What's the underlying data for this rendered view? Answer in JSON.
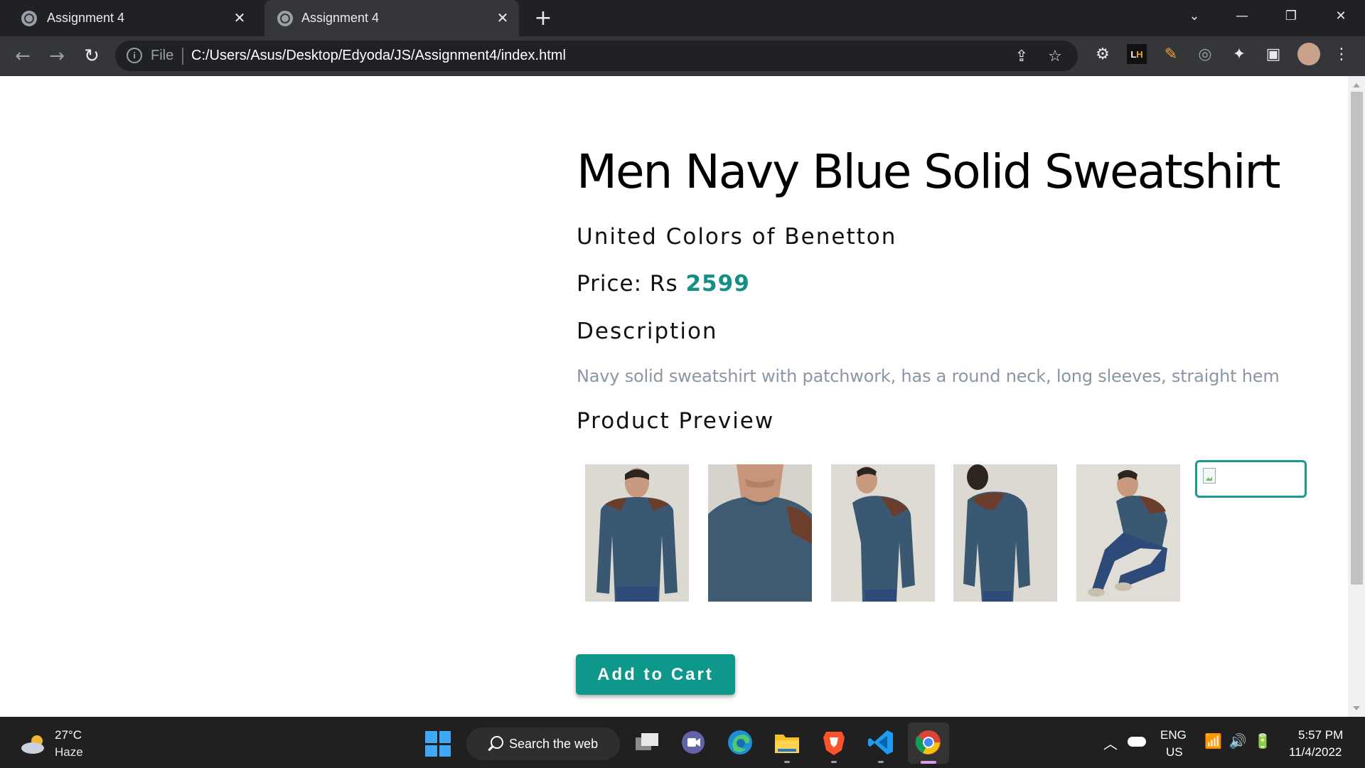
{
  "browser": {
    "tabs": [
      {
        "title": "Assignment 4"
      },
      {
        "title": "Assignment 4"
      }
    ],
    "address": {
      "scheme_label": "File",
      "url": "C:/Users/Asus/Desktop/Edyoda/JS/Assignment4/index.html"
    },
    "extensions": [
      "gear-extension-icon",
      "lighthouse-extension-icon",
      "pen-extension-icon",
      "screen-reader-extension-icon",
      "puzzle-icon",
      "side-panel-icon",
      "profile-avatar"
    ]
  },
  "product": {
    "title": "Men Navy Blue Solid Sweatshirt",
    "brand": "United Colors of Benetton",
    "price_label": "Price: Rs",
    "price_value": "2599",
    "description_heading": "Description",
    "description": "Navy solid sweatshirt with patchwork, has a round neck, long sleeves, straight hem",
    "preview_heading": "Product Preview",
    "preview_images": [
      {
        "alt": "front view"
      },
      {
        "alt": "neck close-up"
      },
      {
        "alt": "side view"
      },
      {
        "alt": "back view"
      },
      {
        "alt": "seated view"
      },
      {
        "alt": "broken image"
      }
    ],
    "cta_label": "Add to Cart",
    "accent_color": "#0e978b"
  },
  "taskbar": {
    "weather_temp": "27°C",
    "weather_condition": "Haze",
    "search_label": "Search the web",
    "lang_line1": "ENG",
    "lang_line2": "US",
    "time": "5:57 PM",
    "date": "11/4/2022"
  }
}
